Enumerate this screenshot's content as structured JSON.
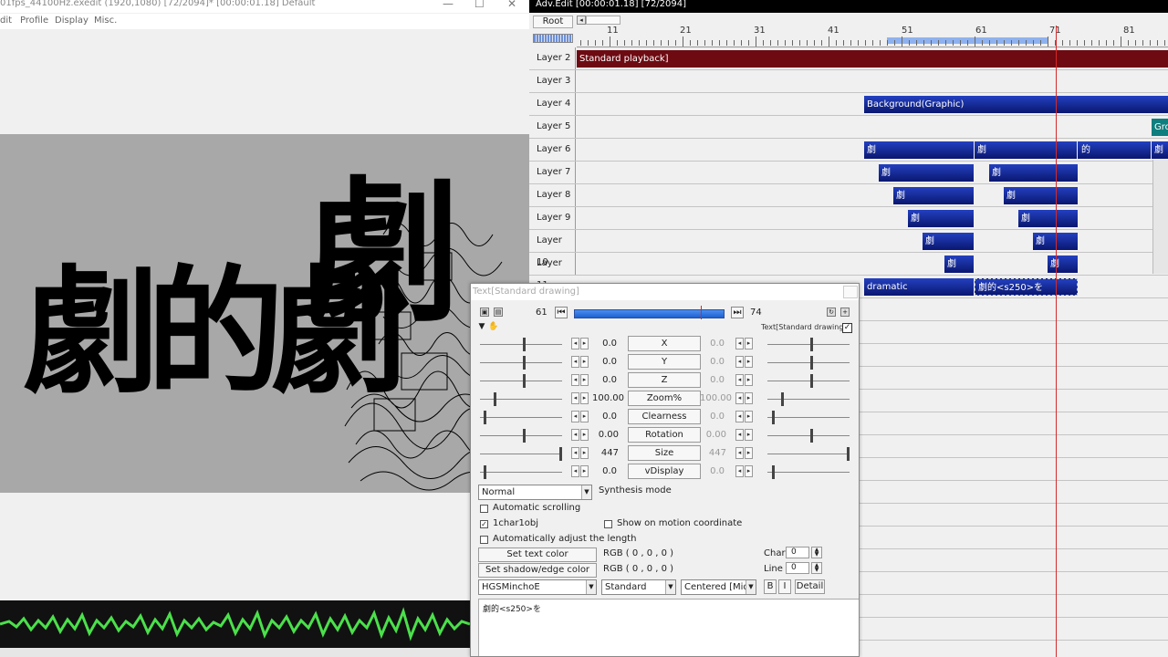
{
  "main_window": {
    "title": "01fps_44100Hz.exedit (1920,1080)  [72/2094]* [00:00:01.18]  Default",
    "menu": [
      "dit",
      "Profile",
      "Display",
      "Misc."
    ],
    "controls": {
      "minimize": "—",
      "maximize": "☐",
      "close": "✕"
    },
    "preview_text": "劇的劇"
  },
  "timeline": {
    "title": "Adv.Edit [00:00:01.18] [72/2094]",
    "root_label": "Root",
    "ruler_labels": [
      "11",
      "21",
      "31",
      "41",
      "51",
      "61",
      "71",
      "81"
    ],
    "layers": [
      {
        "label": "Layer 2"
      },
      {
        "label": "Layer 3"
      },
      {
        "label": "Layer 4"
      },
      {
        "label": "Layer 5"
      },
      {
        "label": "Layer 6"
      },
      {
        "label": "Layer 7"
      },
      {
        "label": "Layer 8"
      },
      {
        "label": "Layer 9"
      },
      {
        "label": "Layer 10"
      },
      {
        "label": "Layer 11"
      }
    ],
    "clips": {
      "layer2": "Standard playback]",
      "layer4": "Background(Graphic)",
      "layer5": "Gro",
      "layer6": [
        "劇",
        "劇",
        "的",
        "劇"
      ],
      "layer7": [
        "劇",
        "劇"
      ],
      "layer8": [
        "劇",
        "劇"
      ],
      "layer9": [
        "劇",
        "劇"
      ],
      "layer10": [
        "劇",
        "劇"
      ],
      "layer11": [
        "劇",
        "劇"
      ],
      "layer12": [
        "dramatic",
        "劇的<s250>を"
      ]
    }
  },
  "dialog": {
    "title": "Text[Standard drawing]",
    "frame_start": "61",
    "frame_end": "74",
    "object_name": "Text[Standard drawing]",
    "object_enabled": "✓",
    "params": [
      {
        "name": "X",
        "value": "0.0",
        "end_value": "0.0"
      },
      {
        "name": "Y",
        "value": "0.0",
        "end_value": "0.0"
      },
      {
        "name": "Z",
        "value": "0.0",
        "end_value": "0.0"
      },
      {
        "name": "Zoom%",
        "value": "100.00",
        "end_value": "100.00"
      },
      {
        "name": "Clearness",
        "value": "0.0",
        "end_value": "0.0"
      },
      {
        "name": "Rotation",
        "value": "0.00",
        "end_value": "0.00"
      },
      {
        "name": "Size",
        "value": "447",
        "end_value": "447"
      },
      {
        "name": "vDisplay",
        "value": "0.0",
        "end_value": "0.0"
      }
    ],
    "synthesis_mode_value": "Normal",
    "synthesis_mode_label": "Synthesis mode",
    "auto_scroll_label": "Automatic scrolling",
    "one_char_label": "1char1obj",
    "one_char_checked": "✓",
    "motion_coord_label": "Show on motion coordinate",
    "auto_adjust_label": "Automatically adjust the length",
    "text_color_button": "Set text color",
    "text_color_value": "RGB ( 0 , 0 , 0 )",
    "shadow_color_button": "Set shadow/edge color",
    "shadow_color_value": "RGB ( 0 , 0 , 0 )",
    "char_label": "Char",
    "char_value": "0",
    "line_label": "Line s",
    "line_value": "0",
    "font_value": "HGSMinchoE",
    "style_value": "Standard",
    "align_value": "Centered [Mid]",
    "bold_label": "B",
    "italic_label": "I",
    "detail_label": "Detail",
    "text_content": "劇的<s250>を"
  }
}
